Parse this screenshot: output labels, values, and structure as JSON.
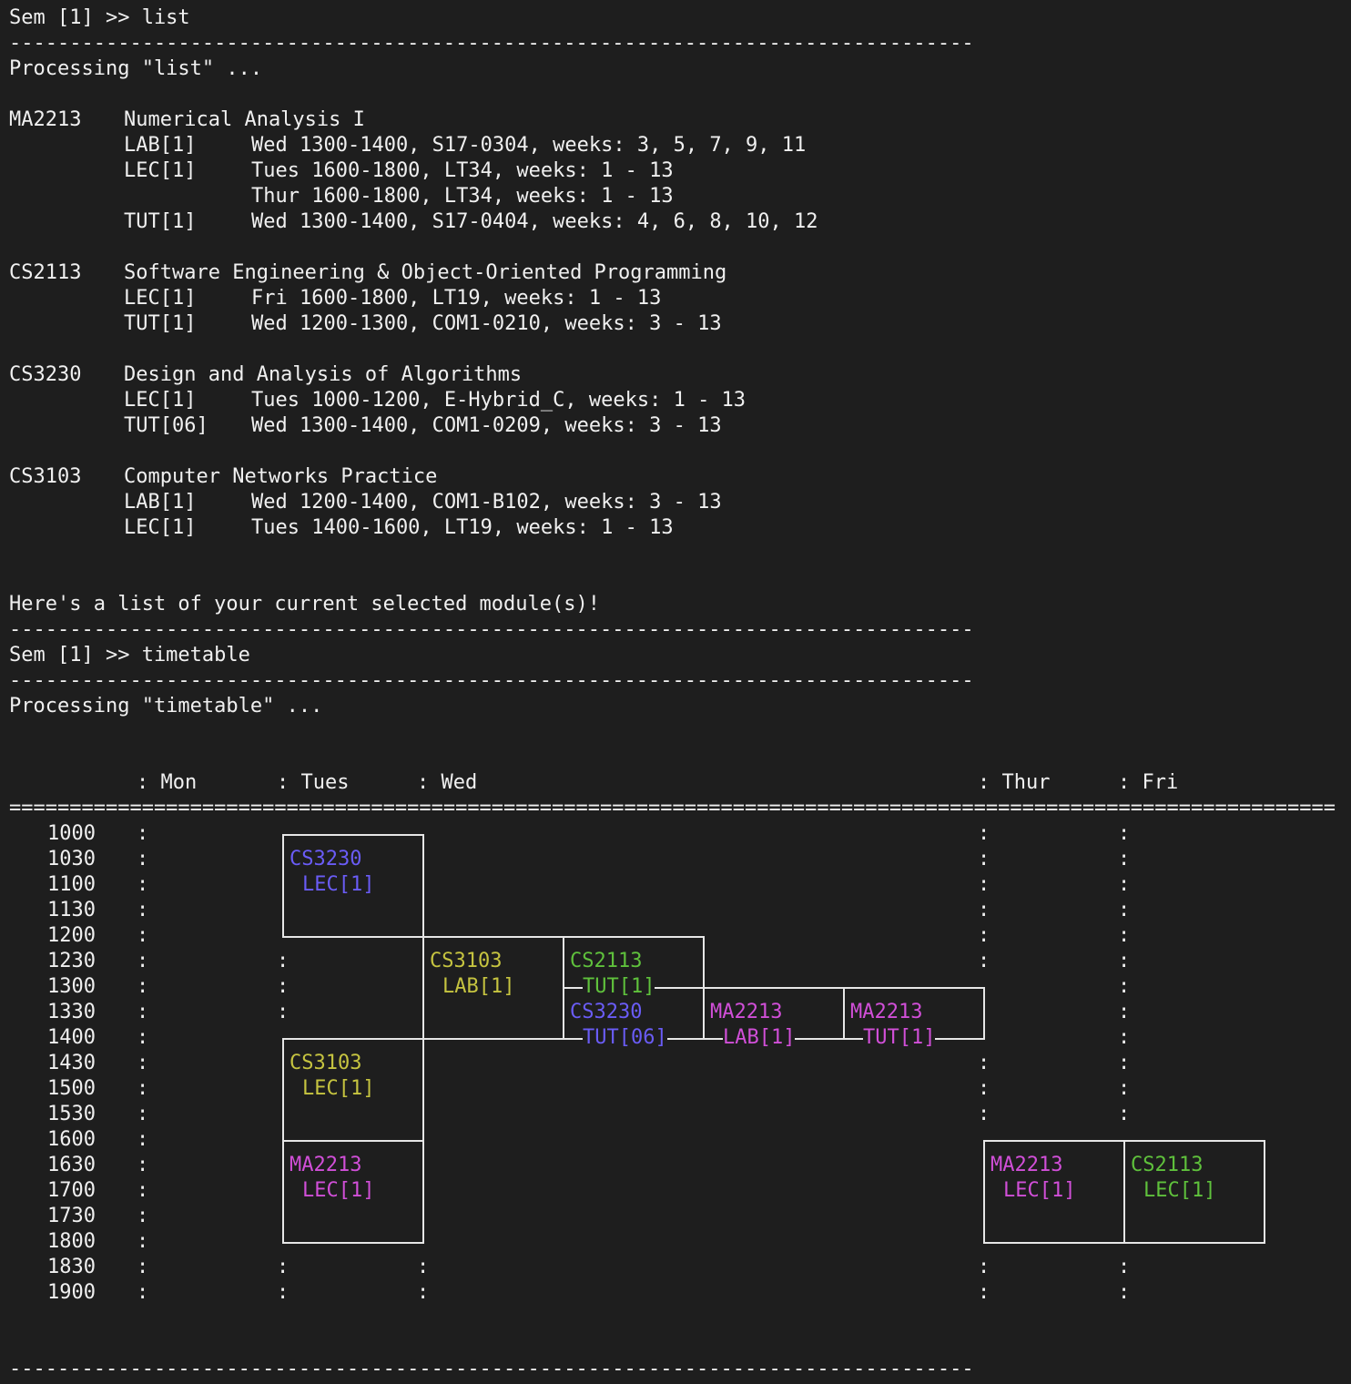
{
  "colors": {
    "background": "#1e1e1e",
    "text": "#f0f0f0",
    "blue": "#6a5cf6",
    "yellow": "#c6c440",
    "green": "#5fc13c",
    "magenta": "#d14fd8"
  },
  "command_output": {
    "prompt1": "Sem [1] >> list",
    "sep_dash": "--------------------------------------------------------------------------------",
    "processing_list": "Processing \"list\" ...",
    "modules": [
      {
        "code": "MA2213",
        "title": "Numerical Analysis I",
        "slots": [
          {
            "type": "LAB[1]",
            "detail": "Wed 1300-1400, S17-0304, weeks: 3, 5, 7, 9, 11"
          },
          {
            "type": "LEC[1]",
            "detail": "Tues 1600-1800, LT34, weeks: 1 - 13"
          },
          {
            "type": "",
            "detail": "Thur 1600-1800, LT34, weeks: 1 - 13"
          },
          {
            "type": "TUT[1]",
            "detail": "Wed 1300-1400, S17-0404, weeks: 4, 6, 8, 10, 12"
          }
        ]
      },
      {
        "code": "CS2113",
        "title": "Software Engineering & Object-Oriented Programming",
        "slots": [
          {
            "type": "LEC[1]",
            "detail": "Fri 1600-1800, LT19, weeks: 1 - 13"
          },
          {
            "type": "TUT[1]",
            "detail": "Wed 1200-1300, COM1-0210, weeks: 3 - 13"
          }
        ]
      },
      {
        "code": "CS3230",
        "title": "Design and Analysis of Algorithms",
        "slots": [
          {
            "type": "LEC[1]",
            "detail": "Tues 1000-1200, E-Hybrid_C, weeks: 1 - 13"
          },
          {
            "type": "TUT[06]",
            "detail": "Wed 1300-1400, COM1-0209, weeks: 3 - 13"
          }
        ]
      },
      {
        "code": "CS3103",
        "title": "Computer Networks Practice",
        "slots": [
          {
            "type": "LAB[1]",
            "detail": "Wed 1200-1400, COM1-B102, weeks: 3 - 13"
          },
          {
            "type": "LEC[1]",
            "detail": "Tues 1400-1600, LT19, weeks: 1 - 13"
          }
        ]
      }
    ],
    "list_summary": "Here's a list of your current selected module(s)!",
    "prompt2": "Sem [1] >> timetable",
    "processing_timetable": "Processing \"timetable\" ..."
  },
  "timetable": {
    "days": [
      "Mon",
      "Tues",
      "Wed",
      "Thur",
      "Fri"
    ],
    "header_sep": "==============================================================================================================",
    "times": [
      "1000",
      "1030",
      "1100",
      "1130",
      "1200",
      "1230",
      "1300",
      "1330",
      "1400",
      "1430",
      "1500",
      "1530",
      "1600",
      "1630",
      "1700",
      "1730",
      "1800",
      "1830",
      "1900"
    ],
    "entries": [
      {
        "module": "CS3230",
        "slot": "LEC[1]",
        "color": "#6a5cf6"
      },
      {
        "module": "CS3103",
        "slot": "LAB[1]",
        "color": "#c6c440"
      },
      {
        "module": "CS2113",
        "slot": "TUT[1]",
        "color": "#5fc13c"
      },
      {
        "module": "CS3230",
        "slot": "TUT[06]",
        "color": "#6a5cf6"
      },
      {
        "module": "MA2213",
        "slot": "LAB[1]",
        "color": "#d14fd8"
      },
      {
        "module": "MA2213",
        "slot": "TUT[1]",
        "color": "#d14fd8"
      },
      {
        "module": "CS3103",
        "slot": "LEC[1]",
        "color": "#c6c440"
      },
      {
        "module": "MA2213",
        "slot": "LEC[1]",
        "color": "#d14fd8"
      },
      {
        "module": "MA2213",
        "slot": "LEC[1]",
        "color": "#d14fd8"
      },
      {
        "module": "CS2113",
        "slot": "LEC[1]",
        "color": "#5fc13c"
      }
    ],
    "footer_sep": "--------------------------------------------------------------------------------"
  }
}
